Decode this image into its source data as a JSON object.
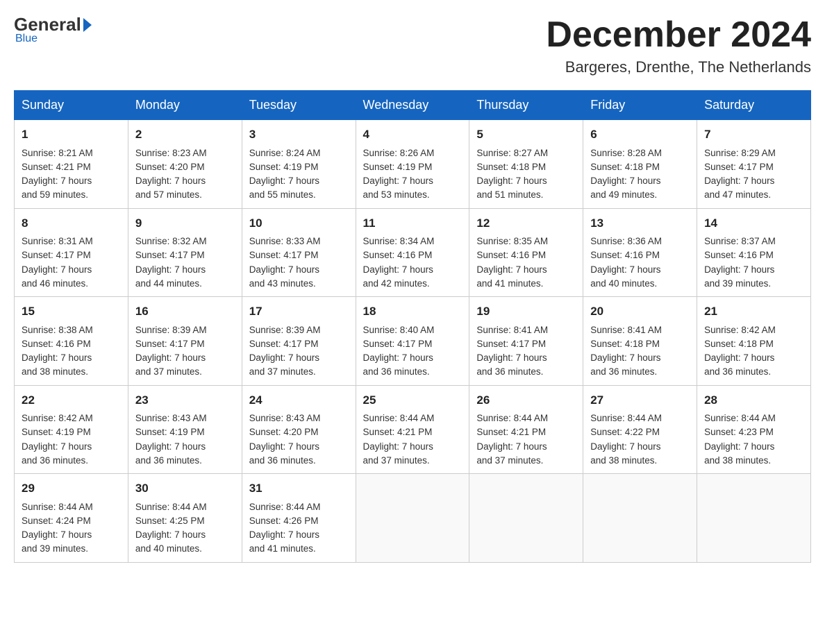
{
  "header": {
    "logo": {
      "general": "General",
      "arrow": "▶",
      "blue_label": "Blue"
    },
    "month_title": "December 2024",
    "location": "Bargeres, Drenthe, The Netherlands"
  },
  "days_of_week": [
    "Sunday",
    "Monday",
    "Tuesday",
    "Wednesday",
    "Thursday",
    "Friday",
    "Saturday"
  ],
  "weeks": [
    [
      {
        "day": "1",
        "sunrise": "Sunrise: 8:21 AM",
        "sunset": "Sunset: 4:21 PM",
        "daylight": "Daylight: 7 hours",
        "minutes": "and 59 minutes."
      },
      {
        "day": "2",
        "sunrise": "Sunrise: 8:23 AM",
        "sunset": "Sunset: 4:20 PM",
        "daylight": "Daylight: 7 hours",
        "minutes": "and 57 minutes."
      },
      {
        "day": "3",
        "sunrise": "Sunrise: 8:24 AM",
        "sunset": "Sunset: 4:19 PM",
        "daylight": "Daylight: 7 hours",
        "minutes": "and 55 minutes."
      },
      {
        "day": "4",
        "sunrise": "Sunrise: 8:26 AM",
        "sunset": "Sunset: 4:19 PM",
        "daylight": "Daylight: 7 hours",
        "minutes": "and 53 minutes."
      },
      {
        "day": "5",
        "sunrise": "Sunrise: 8:27 AM",
        "sunset": "Sunset: 4:18 PM",
        "daylight": "Daylight: 7 hours",
        "minutes": "and 51 minutes."
      },
      {
        "day": "6",
        "sunrise": "Sunrise: 8:28 AM",
        "sunset": "Sunset: 4:18 PM",
        "daylight": "Daylight: 7 hours",
        "minutes": "and 49 minutes."
      },
      {
        "day": "7",
        "sunrise": "Sunrise: 8:29 AM",
        "sunset": "Sunset: 4:17 PM",
        "daylight": "Daylight: 7 hours",
        "minutes": "and 47 minutes."
      }
    ],
    [
      {
        "day": "8",
        "sunrise": "Sunrise: 8:31 AM",
        "sunset": "Sunset: 4:17 PM",
        "daylight": "Daylight: 7 hours",
        "minutes": "and 46 minutes."
      },
      {
        "day": "9",
        "sunrise": "Sunrise: 8:32 AM",
        "sunset": "Sunset: 4:17 PM",
        "daylight": "Daylight: 7 hours",
        "minutes": "and 44 minutes."
      },
      {
        "day": "10",
        "sunrise": "Sunrise: 8:33 AM",
        "sunset": "Sunset: 4:17 PM",
        "daylight": "Daylight: 7 hours",
        "minutes": "and 43 minutes."
      },
      {
        "day": "11",
        "sunrise": "Sunrise: 8:34 AM",
        "sunset": "Sunset: 4:16 PM",
        "daylight": "Daylight: 7 hours",
        "minutes": "and 42 minutes."
      },
      {
        "day": "12",
        "sunrise": "Sunrise: 8:35 AM",
        "sunset": "Sunset: 4:16 PM",
        "daylight": "Daylight: 7 hours",
        "minutes": "and 41 minutes."
      },
      {
        "day": "13",
        "sunrise": "Sunrise: 8:36 AM",
        "sunset": "Sunset: 4:16 PM",
        "daylight": "Daylight: 7 hours",
        "minutes": "and 40 minutes."
      },
      {
        "day": "14",
        "sunrise": "Sunrise: 8:37 AM",
        "sunset": "Sunset: 4:16 PM",
        "daylight": "Daylight: 7 hours",
        "minutes": "and 39 minutes."
      }
    ],
    [
      {
        "day": "15",
        "sunrise": "Sunrise: 8:38 AM",
        "sunset": "Sunset: 4:16 PM",
        "daylight": "Daylight: 7 hours",
        "minutes": "and 38 minutes."
      },
      {
        "day": "16",
        "sunrise": "Sunrise: 8:39 AM",
        "sunset": "Sunset: 4:17 PM",
        "daylight": "Daylight: 7 hours",
        "minutes": "and 37 minutes."
      },
      {
        "day": "17",
        "sunrise": "Sunrise: 8:39 AM",
        "sunset": "Sunset: 4:17 PM",
        "daylight": "Daylight: 7 hours",
        "minutes": "and 37 minutes."
      },
      {
        "day": "18",
        "sunrise": "Sunrise: 8:40 AM",
        "sunset": "Sunset: 4:17 PM",
        "daylight": "Daylight: 7 hours",
        "minutes": "and 36 minutes."
      },
      {
        "day": "19",
        "sunrise": "Sunrise: 8:41 AM",
        "sunset": "Sunset: 4:17 PM",
        "daylight": "Daylight: 7 hours",
        "minutes": "and 36 minutes."
      },
      {
        "day": "20",
        "sunrise": "Sunrise: 8:41 AM",
        "sunset": "Sunset: 4:18 PM",
        "daylight": "Daylight: 7 hours",
        "minutes": "and 36 minutes."
      },
      {
        "day": "21",
        "sunrise": "Sunrise: 8:42 AM",
        "sunset": "Sunset: 4:18 PM",
        "daylight": "Daylight: 7 hours",
        "minutes": "and 36 minutes."
      }
    ],
    [
      {
        "day": "22",
        "sunrise": "Sunrise: 8:42 AM",
        "sunset": "Sunset: 4:19 PM",
        "daylight": "Daylight: 7 hours",
        "minutes": "and 36 minutes."
      },
      {
        "day": "23",
        "sunrise": "Sunrise: 8:43 AM",
        "sunset": "Sunset: 4:19 PM",
        "daylight": "Daylight: 7 hours",
        "minutes": "and 36 minutes."
      },
      {
        "day": "24",
        "sunrise": "Sunrise: 8:43 AM",
        "sunset": "Sunset: 4:20 PM",
        "daylight": "Daylight: 7 hours",
        "minutes": "and 36 minutes."
      },
      {
        "day": "25",
        "sunrise": "Sunrise: 8:44 AM",
        "sunset": "Sunset: 4:21 PM",
        "daylight": "Daylight: 7 hours",
        "minutes": "and 37 minutes."
      },
      {
        "day": "26",
        "sunrise": "Sunrise: 8:44 AM",
        "sunset": "Sunset: 4:21 PM",
        "daylight": "Daylight: 7 hours",
        "minutes": "and 37 minutes."
      },
      {
        "day": "27",
        "sunrise": "Sunrise: 8:44 AM",
        "sunset": "Sunset: 4:22 PM",
        "daylight": "Daylight: 7 hours",
        "minutes": "and 38 minutes."
      },
      {
        "day": "28",
        "sunrise": "Sunrise: 8:44 AM",
        "sunset": "Sunset: 4:23 PM",
        "daylight": "Daylight: 7 hours",
        "minutes": "and 38 minutes."
      }
    ],
    [
      {
        "day": "29",
        "sunrise": "Sunrise: 8:44 AM",
        "sunset": "Sunset: 4:24 PM",
        "daylight": "Daylight: 7 hours",
        "minutes": "and 39 minutes."
      },
      {
        "day": "30",
        "sunrise": "Sunrise: 8:44 AM",
        "sunset": "Sunset: 4:25 PM",
        "daylight": "Daylight: 7 hours",
        "minutes": "and 40 minutes."
      },
      {
        "day": "31",
        "sunrise": "Sunrise: 8:44 AM",
        "sunset": "Sunset: 4:26 PM",
        "daylight": "Daylight: 7 hours",
        "minutes": "and 41 minutes."
      },
      null,
      null,
      null,
      null
    ]
  ]
}
